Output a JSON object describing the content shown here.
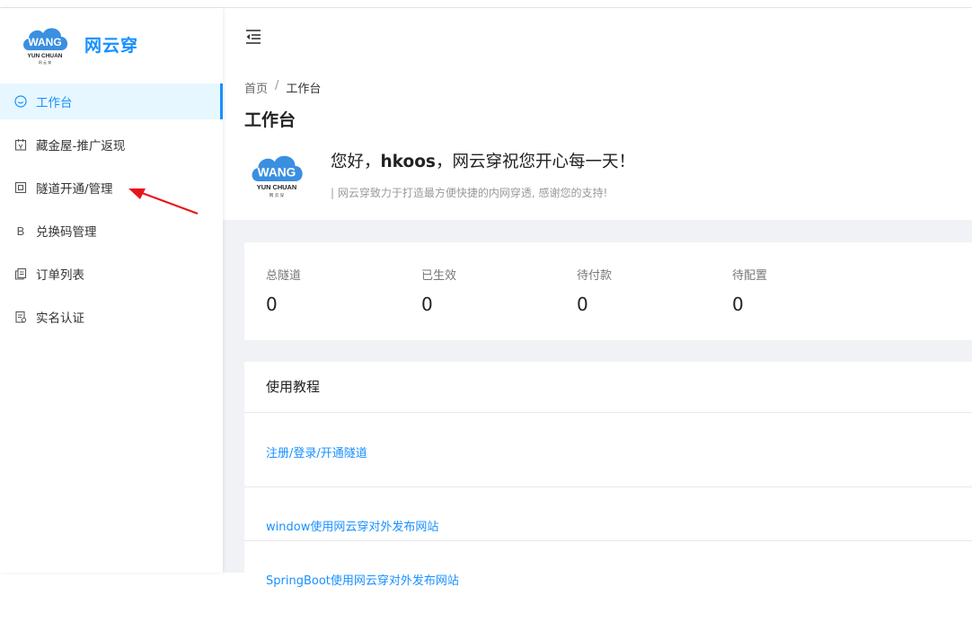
{
  "brand": {
    "name": "网云穿",
    "logo_text": "WANG",
    "logo_sub": "YUN CHUAN",
    "logo_tiny": "网 云 穿"
  },
  "sidebar": {
    "items": [
      {
        "label": "工作台",
        "icon": "dashboard-icon",
        "active": true
      },
      {
        "label": "藏金屋-推广返现",
        "icon": "calendar-icon"
      },
      {
        "label": "隧道开通/管理",
        "icon": "tunnel-icon"
      },
      {
        "label": "兑换码管理",
        "icon": "b-icon"
      },
      {
        "label": "订单列表",
        "icon": "copy-icon"
      },
      {
        "label": "实名认证",
        "icon": "id-icon"
      }
    ]
  },
  "breadcrumb": {
    "home": "首页",
    "sep": "/",
    "current": "工作台"
  },
  "page": {
    "title": "工作台",
    "greeting_prefix": "您好，",
    "username": "hkoos",
    "greeting_suffix": "，网云穿祝您开心每一天！",
    "subtitle": "| 网云穿致力于打造最方便快捷的内网穿透, 感谢您的支持!"
  },
  "stats": [
    {
      "label": "总隧道",
      "value": "0"
    },
    {
      "label": "已生效",
      "value": "0"
    },
    {
      "label": "待付款",
      "value": "0"
    },
    {
      "label": "待配置",
      "value": "0"
    }
  ],
  "tutorial": {
    "title": "使用教程",
    "links": [
      "注册/登录/开通隧道",
      "window使用网云穿对外发布网站",
      "SpringBoot使用网云穿对外发布网站"
    ]
  },
  "colors": {
    "accent": "#1890ff",
    "annotation": "#e8141a"
  }
}
